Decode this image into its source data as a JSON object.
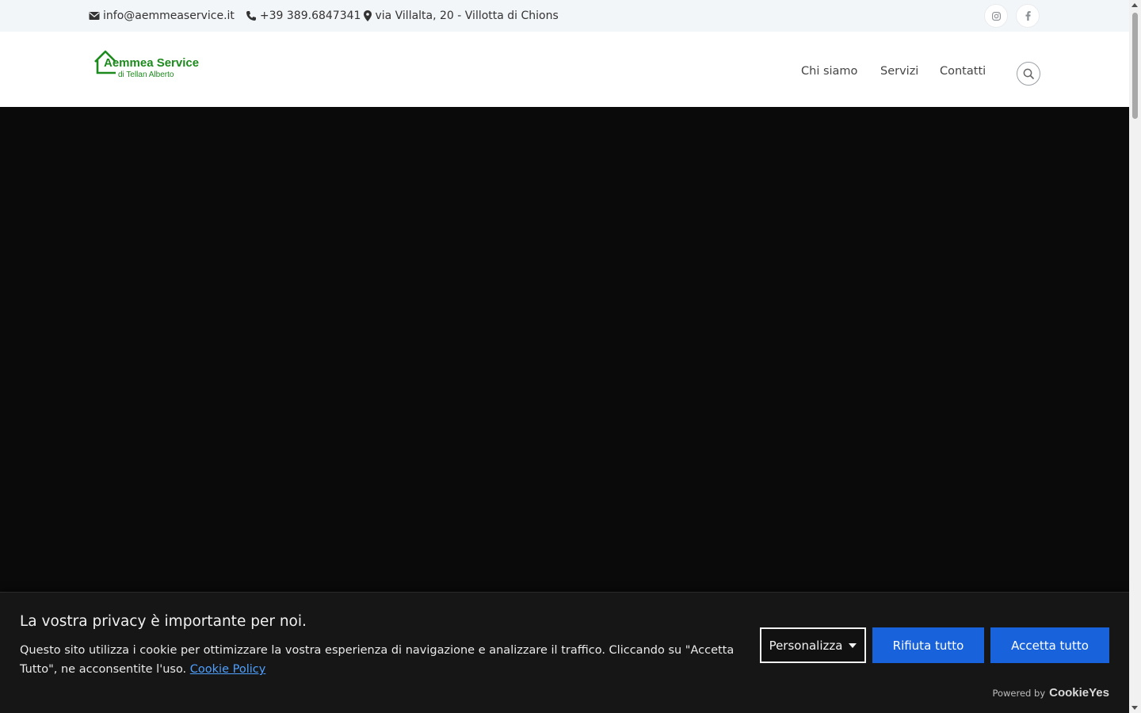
{
  "topbar": {
    "email": "info@aemmeaservice.it",
    "phone": "+39 389.6847341",
    "address": "via Villalta, 20 - Villotta di Chions",
    "social": [
      "instagram-icon",
      "facebook-icon"
    ]
  },
  "header": {
    "logo": {
      "name": "Aemmea Service",
      "subtitle": "di Tellan Alberto"
    },
    "nav": [
      "Chi siamo",
      "Servizi",
      "Contatti"
    ]
  },
  "cookie_banner": {
    "title": "La vostra privacy è importante per noi.",
    "description": "Questo sito utilizza i cookie per ottimizzare la vostra esperienza di navigazione e analizzare il traffico. Cliccando su \"Accetta Tutto\", ne acconsentite l'uso.",
    "policy_link": "Cookie Policy",
    "customize_label": "Personalizza",
    "reject_label": "Rifiuta tutto",
    "accept_label": "Accetta tutto",
    "powered_by": "Powered by",
    "powered_brand": "CookieYes"
  },
  "colors": {
    "brand_green": "#1c8a1c",
    "button_blue": "#1863dc",
    "hero_background": "#0a0a0a",
    "banner_background": "#161616"
  }
}
